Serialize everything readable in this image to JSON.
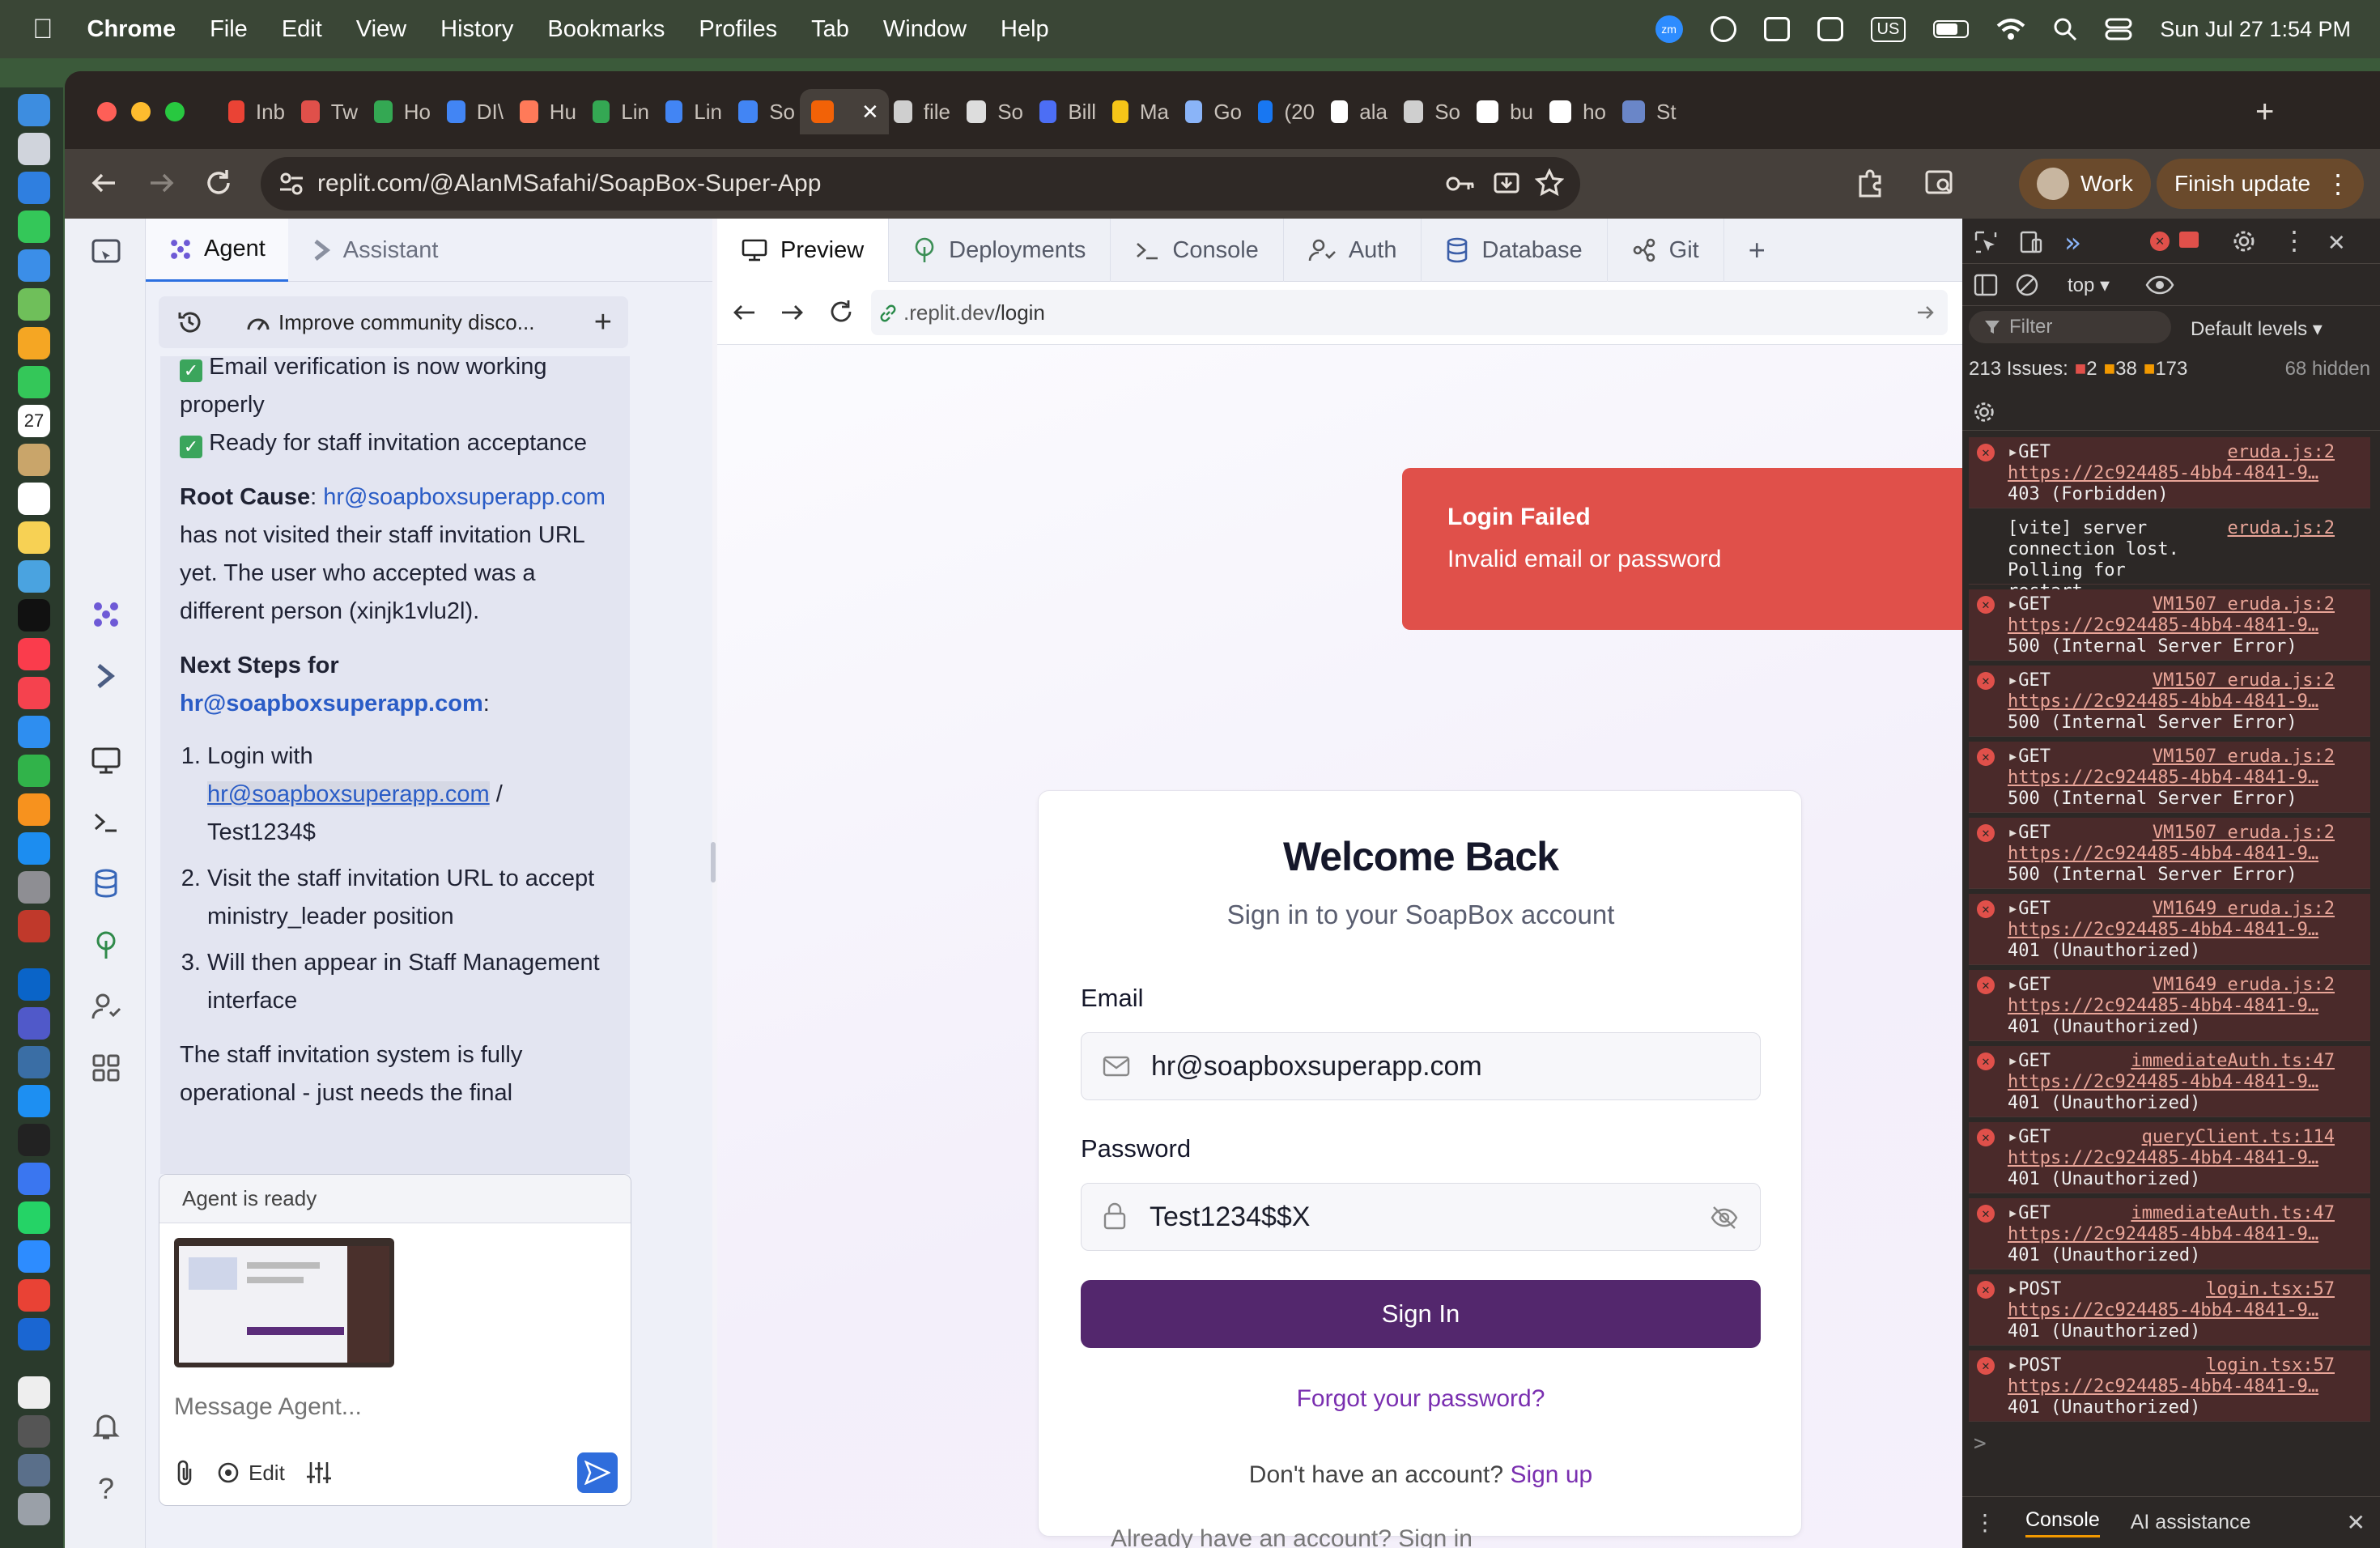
{
  "menubar": {
    "app": "Chrome",
    "items": [
      "File",
      "Edit",
      "View",
      "History",
      "Bookmarks",
      "Profiles",
      "Tab",
      "Window",
      "Help"
    ],
    "status_badges": [
      "zm",
      "US"
    ],
    "clock": "Sun Jul 27  1:54 PM"
  },
  "dock": {
    "calendar_day": "27"
  },
  "browser": {
    "tabs": [
      {
        "label": "Inb",
        "color": "#ea4335"
      },
      {
        "label": "Tw",
        "color": "#e0504a"
      },
      {
        "label": "Ho",
        "color": "#34a853"
      },
      {
        "label": "DI\\",
        "color": "#4285f4"
      },
      {
        "label": "Hu",
        "color": "#ff7a59"
      },
      {
        "label": "Lin",
        "color": "#34a853"
      },
      {
        "label": "Lin",
        "color": "#4285f4"
      },
      {
        "label": "So",
        "color": "#4285f4"
      },
      {
        "label": "",
        "color": "#f26207"
      },
      {
        "label": "file",
        "color": "#cfcfcf"
      },
      {
        "label": "So",
        "color": "#dddddd"
      },
      {
        "label": "Bill",
        "color": "#4c6ef5"
      },
      {
        "label": "Ma",
        "color": "#f5c518"
      },
      {
        "label": "Go",
        "color": "#8ab4f8"
      },
      {
        "label": "(20",
        "color": "#1877f2"
      },
      {
        "label": "ala",
        "color": "#ffffff"
      },
      {
        "label": "So",
        "color": "#cfcfcf"
      },
      {
        "label": "bu",
        "color": "#ffffff"
      },
      {
        "label": "ho",
        "color": "#ffffff"
      },
      {
        "label": "St",
        "color": "#6a86c8"
      }
    ],
    "url": "replit.com/@AlanMSafahi/SoapBox-Super-App",
    "profile_label": "Work",
    "update_label": "Finish update"
  },
  "agent": {
    "tabs": [
      "Agent",
      "Assistant"
    ],
    "conversation_title": "Improve community disco...",
    "messages": {
      "line1": "Email verification is now working properly",
      "line2": "Ready for staff invitation acceptance",
      "root_cause_label": "Root Cause",
      "root_cause_email": "hr@soapboxsuperapp.com",
      "root_cause_text": "has not visited their staff invitation URL yet. The user who accepted was a different person (xinjk1vlu2l).",
      "next_steps_label": "Next Steps for",
      "next_steps_email": "hr@soapboxsuperapp.com",
      "step1_prefix": "Login with",
      "step1_email": "hr@soapboxsuperapp.com",
      "step1_suffix": "/ Test1234$",
      "step2": "Visit the staff invitation URL to accept ministry_leader position",
      "step3": "Will then appear in Staff Management interface",
      "closing": "The staff invitation system is fully operational - just needs the final"
    },
    "status": "Agent is ready",
    "composer_placeholder": "Message Agent...",
    "edit_label": "Edit"
  },
  "preview": {
    "tabs": [
      "Preview",
      "Deployments",
      "Console",
      "Auth",
      "Database",
      "Git"
    ],
    "url_host": ".replit.dev",
    "url_path": "/login",
    "toast": {
      "title": "Login Failed",
      "message": "Invalid email or password"
    },
    "card": {
      "title": "Welcome Back",
      "subtitle": "Sign in to your SoapBox account",
      "email_label": "Email",
      "email_value": "hr@soapboxsuperapp.com",
      "password_label": "Password",
      "password_value": "Test1234$$X",
      "sign_in": "Sign In",
      "forgot": "Forgot your password?",
      "no_account": "Don't have an account?",
      "sign_up": "Sign up"
    },
    "bottom_peek": "Already have an account? Sign in"
  },
  "devtools": {
    "context": "top",
    "filter_placeholder": "Filter",
    "levels": "Default levels",
    "issues_label": "213 Issues:",
    "issue_counts": [
      "2",
      "38",
      "173"
    ],
    "hidden": "68 hidden",
    "logs": [
      {
        "method": "GET",
        "source": "eruda.js:2",
        "url": "https://2c924485-4bb4-4841-9…",
        "status": "403 (Forbidden)",
        "error": true
      },
      {
        "method": "",
        "source": "eruda.js:2",
        "url": "",
        "status": "[vite] server connection lost. Polling for restart...",
        "error": false
      },
      {
        "method": "GET",
        "source": "VM1507 eruda.js:2",
        "url": "https://2c924485-4bb4-4841-9…",
        "status": "500 (Internal Server Error)",
        "error": true
      },
      {
        "method": "GET",
        "source": "VM1507 eruda.js:2",
        "url": "https://2c924485-4bb4-4841-9…",
        "status": "500 (Internal Server Error)",
        "error": true
      },
      {
        "method": "GET",
        "source": "VM1507 eruda.js:2",
        "url": "https://2c924485-4bb4-4841-9…",
        "status": "500 (Internal Server Error)",
        "error": true
      },
      {
        "method": "GET",
        "source": "VM1507 eruda.js:2",
        "url": "https://2c924485-4bb4-4841-9…",
        "status": "500 (Internal Server Error)",
        "error": true
      },
      {
        "method": "GET",
        "source": "VM1649 eruda.js:2",
        "url": "https://2c924485-4bb4-4841-9…",
        "status": "401 (Unauthorized)",
        "error": true
      },
      {
        "method": "GET",
        "source": "VM1649 eruda.js:2",
        "url": "https://2c924485-4bb4-4841-9…",
        "status": "401 (Unauthorized)",
        "error": true
      },
      {
        "method": "GET",
        "source": "immediateAuth.ts:47",
        "url": "https://2c924485-4bb4-4841-9…",
        "status": "401 (Unauthorized)",
        "error": true
      },
      {
        "method": "GET",
        "source": "queryClient.ts:114",
        "url": "https://2c924485-4bb4-4841-9…",
        "status": "401 (Unauthorized)",
        "error": true
      },
      {
        "method": "GET",
        "source": "immediateAuth.ts:47",
        "url": "https://2c924485-4bb4-4841-9…",
        "status": "401 (Unauthorized)",
        "error": true
      },
      {
        "method": "POST",
        "source": "login.tsx:57",
        "url": "https://2c924485-4bb4-4841-9…",
        "status": "401 (Unauthorized)",
        "error": true
      },
      {
        "method": "POST",
        "source": "login.tsx:57",
        "url": "https://2c924485-4bb4-4841-9…",
        "status": "401 (Unauthorized)",
        "error": true
      }
    ],
    "bottom_tabs": [
      "Console",
      "AI assistance"
    ]
  }
}
